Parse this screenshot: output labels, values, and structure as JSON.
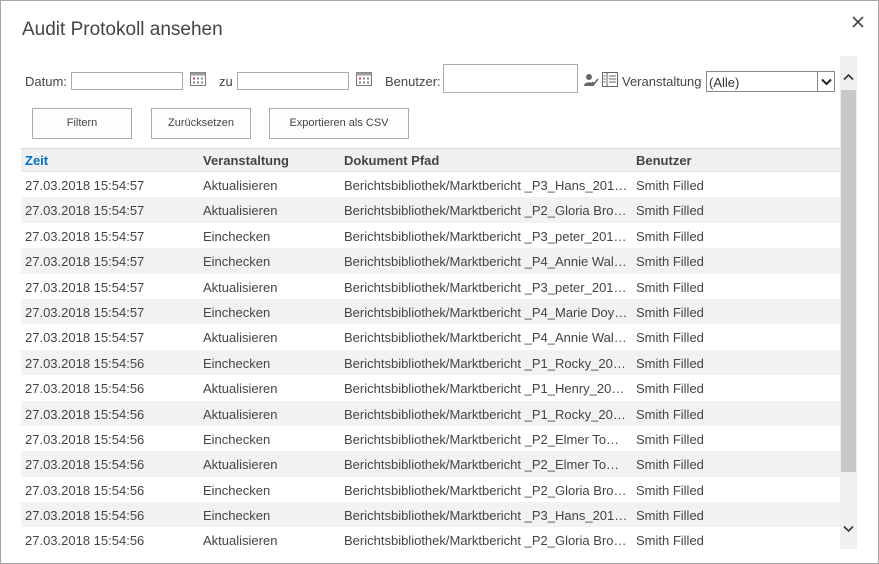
{
  "dialog": {
    "title": "Audit Protokoll ansehen",
    "close_icon": "close-icon"
  },
  "filters": {
    "date_label": "Datum:",
    "date_from_value": "",
    "to_label": "zu",
    "date_to_value": "",
    "user_label": "Benutzer:",
    "user_value": "",
    "event_label": "Veranstaltung",
    "event_selected": "(Alle)",
    "icons": [
      "calendar-icon",
      "calendar-icon",
      "check-names-icon",
      "address-book-icon",
      "chevron-down-icon"
    ]
  },
  "buttons": {
    "filter": "Filtern",
    "reset": "Zurücksetzen",
    "export": "Exportieren als CSV"
  },
  "table": {
    "columns": [
      "Zeit",
      "Veranstaltung",
      "Dokument Pfad",
      "Benutzer"
    ],
    "rows": [
      [
        "27.03.2018 15:54:57",
        "Aktualisieren",
        "Berichtsbibliothek/Marktbericht _P3_Hans_2018…",
        "Smith Filled"
      ],
      [
        "27.03.2018 15:54:57",
        "Aktualisieren",
        "Berichtsbibliothek/Marktbericht _P2_Gloria Bro…",
        "Smith Filled"
      ],
      [
        "27.03.2018 15:54:57",
        "Einchecken",
        "Berichtsbibliothek/Marktbericht _P3_peter_2018…",
        "Smith Filled"
      ],
      [
        "27.03.2018 15:54:57",
        "Einchecken",
        "Berichtsbibliothek/Marktbericht _P4_Annie Wal…",
        "Smith Filled"
      ],
      [
        "27.03.2018 15:54:57",
        "Aktualisieren",
        "Berichtsbibliothek/Marktbericht _P3_peter_2018…",
        "Smith Filled"
      ],
      [
        "27.03.2018 15:54:57",
        "Einchecken",
        "Berichtsbibliothek/Marktbericht _P4_Marie Doyl…",
        "Smith Filled"
      ],
      [
        "27.03.2018 15:54:57",
        "Aktualisieren",
        "Berichtsbibliothek/Marktbericht _P4_Annie Wal…",
        "Smith Filled"
      ],
      [
        "27.03.2018 15:54:56",
        "Einchecken",
        "Berichtsbibliothek/Marktbericht _P1_Rocky_201…",
        "Smith Filled"
      ],
      [
        "27.03.2018 15:54:56",
        "Aktualisieren",
        "Berichtsbibliothek/Marktbericht _P1_Henry_201…",
        "Smith Filled"
      ],
      [
        "27.03.2018 15:54:56",
        "Aktualisieren",
        "Berichtsbibliothek/Marktbericht _P1_Rocky_201…",
        "Smith Filled"
      ],
      [
        "27.03.2018 15:54:56",
        "Einchecken",
        "Berichtsbibliothek/Marktbericht _P2_Elmer Tom…",
        "Smith Filled"
      ],
      [
        "27.03.2018 15:54:56",
        "Aktualisieren",
        "Berichtsbibliothek/Marktbericht _P2_Elmer Tom…",
        "Smith Filled"
      ],
      [
        "27.03.2018 15:54:56",
        "Einchecken",
        "Berichtsbibliothek/Marktbericht _P2_Gloria Bro…",
        "Smith Filled"
      ],
      [
        "27.03.2018 15:54:56",
        "Einchecken",
        "Berichtsbibliothek/Marktbericht _P3_Hans_2018…",
        "Smith Filled"
      ],
      [
        "27.03.2018 15:54:56",
        "Aktualisieren",
        "Berichtsbibliothek/Marktbericht _P2_Gloria Bro…",
        "Smith Filled"
      ]
    ]
  },
  "colors": {
    "sort_link": "#0072c6",
    "row_alt": "#f2f2f2",
    "header_bg": "#f0f0f0",
    "scroll_thumb": "#c8c8c8"
  }
}
